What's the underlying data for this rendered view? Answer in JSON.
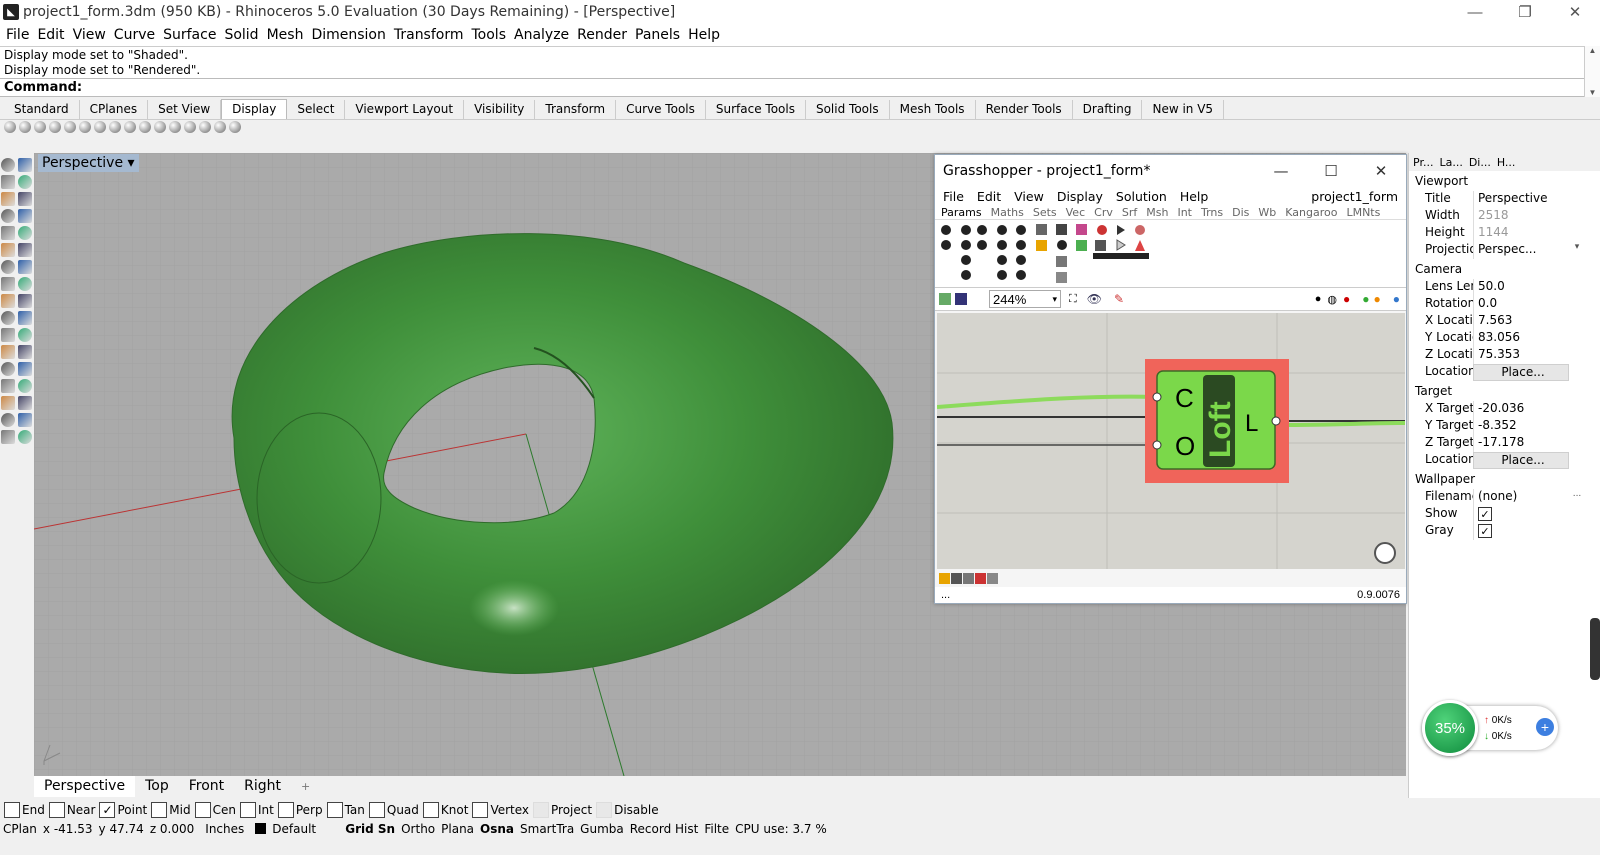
{
  "window": {
    "title": "project1_form.3dm (950 KB) - Rhinoceros 5.0 Evaluation (30 Days Remaining) - [Perspective]",
    "minimize": "—",
    "restore": "❐",
    "close": "✕"
  },
  "menu": [
    "File",
    "Edit",
    "View",
    "Curve",
    "Surface",
    "Solid",
    "Mesh",
    "Dimension",
    "Transform",
    "Tools",
    "Analyze",
    "Render",
    "Panels",
    "Help"
  ],
  "command": {
    "history": [
      "Display mode set to \"Shaded\".",
      "Display mode set to \"Rendered\"."
    ],
    "prompt": "Command:",
    "value": ""
  },
  "toolbar_tabs": [
    "Standard",
    "CPlanes",
    "Set View",
    "Display",
    "Select",
    "Viewport Layout",
    "Visibility",
    "Transform",
    "Curve Tools",
    "Surface Tools",
    "Solid Tools",
    "Mesh Tools",
    "Render Tools",
    "Drafting",
    "New in V5"
  ],
  "active_toolbar_tab": "Display",
  "viewport": {
    "label": "Perspective",
    "label_arrow": "▾",
    "tabs": [
      "Perspective",
      "Top",
      "Front",
      "Right"
    ],
    "add_tab": "+",
    "shape_color": "#3f8f3a"
  },
  "osnaps": [
    {
      "label": "End",
      "checked": false
    },
    {
      "label": "Near",
      "checked": false
    },
    {
      "label": "Point",
      "checked": true
    },
    {
      "label": "Mid",
      "checked": false
    },
    {
      "label": "Cen",
      "checked": false
    },
    {
      "label": "Int",
      "checked": false
    },
    {
      "label": "Perp",
      "checked": false
    },
    {
      "label": "Tan",
      "checked": false
    },
    {
      "label": "Quad",
      "checked": false
    },
    {
      "label": "Knot",
      "checked": false
    },
    {
      "label": "Vertex",
      "checked": false
    },
    {
      "label": "Project",
      "checked": false,
      "disabled": true
    },
    {
      "label": "Disable",
      "checked": false,
      "disabled": true
    }
  ],
  "statusbar": {
    "cplane": "CPlan",
    "x": "x -41.53",
    "y": "y 47.74",
    "z": "z 0.000",
    "units": "Inches",
    "layer": "Default",
    "grid_snap": "Grid Sn",
    "ortho": "Ortho",
    "planar": "Plana",
    "osnap": "Osna",
    "smarttrack": "SmartTra",
    "gumball": "Gumba",
    "record_history": "Record Hist",
    "filter": "Filte",
    "cpu": "CPU use: 3.7 %"
  },
  "grasshopper": {
    "title": "Grasshopper - project1_form*",
    "menu": [
      "File",
      "Edit",
      "View",
      "Display",
      "Solution",
      "Help"
    ],
    "document": "project1_form",
    "tabs": [
      "Params",
      "Maths",
      "Sets",
      "Vec",
      "Crv",
      "Srf",
      "Msh",
      "Int",
      "Trns",
      "Dis",
      "Wb",
      "Kangaroo",
      "LMNts"
    ],
    "active_tab": "Params",
    "zoom": "244%",
    "component": {
      "name": "Loft",
      "input1": "C",
      "input2": "O",
      "output": "L"
    },
    "status_left": "...",
    "version": "0.9.0076"
  },
  "properties": {
    "tabs": [
      "Pr...",
      "La...",
      "Di...",
      "H..."
    ],
    "sections": [
      {
        "title": "Viewport",
        "rows": [
          {
            "key": "Title",
            "value": "Perspective"
          },
          {
            "key": "Width",
            "value": "2518",
            "grey": true
          },
          {
            "key": "Height",
            "value": "1144",
            "grey": true
          },
          {
            "key": "Projection",
            "value": "Perspec...",
            "dropdown": true
          }
        ]
      },
      {
        "title": "Camera",
        "rows": [
          {
            "key": "Lens Len...",
            "value": "50.0"
          },
          {
            "key": "Rotation",
            "value": "0.0"
          },
          {
            "key": "X Location",
            "value": "7.563"
          },
          {
            "key": "Y Location",
            "value": "83.056"
          },
          {
            "key": "Z Location",
            "value": "75.353"
          },
          {
            "key": "Location",
            "value": "Place...",
            "button": true
          }
        ]
      },
      {
        "title": "Target",
        "rows": [
          {
            "key": "X Target",
            "value": "-20.036"
          },
          {
            "key": "Y Target",
            "value": "-8.352"
          },
          {
            "key": "Z Target",
            "value": "-17.178"
          },
          {
            "key": "Location",
            "value": "Place...",
            "button": true
          }
        ]
      },
      {
        "title": "Wallpaper",
        "rows": [
          {
            "key": "Filename",
            "value": "(none)",
            "more": "..."
          },
          {
            "key": "Show",
            "checkbox": true,
            "checked": true
          },
          {
            "key": "Gray",
            "checkbox": true,
            "checked": true
          }
        ]
      }
    ]
  },
  "network_widget": {
    "percent": "35%",
    "up": "0K/s",
    "down": "0K/s",
    "plus": "+"
  }
}
